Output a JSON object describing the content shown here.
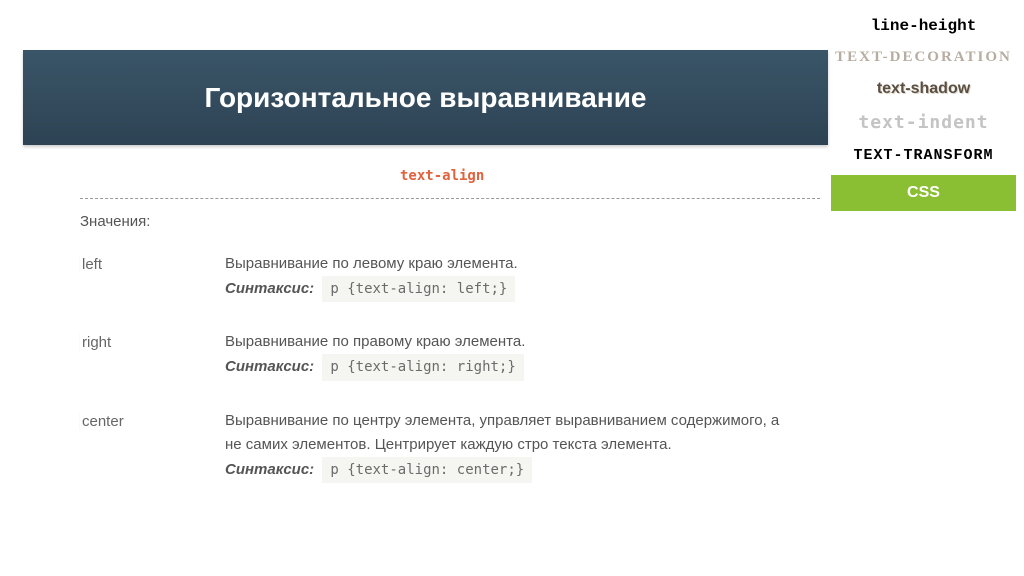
{
  "header": {
    "title": "Горизонтальное выравнивание"
  },
  "sidebar": {
    "items": [
      {
        "label": "line-height"
      },
      {
        "label": "TEXT-DECORATION"
      },
      {
        "label": "text-shadow"
      },
      {
        "label": "text-indent"
      },
      {
        "label": "TEXT-TRANSFORM"
      }
    ],
    "css_label": "CSS"
  },
  "subtitle": "text-align",
  "values_label": "Значения:",
  "rows": [
    {
      "key": "left",
      "desc": "Выравнивание по левому краю элемента.",
      "syntax_label": "Синтаксис:",
      "code": "p  {text-align: left;}"
    },
    {
      "key": "right",
      "desc": "Выравнивание по правому краю элемента.",
      "syntax_label": "Синтаксис:",
      "code": "p  {text-align: right;}"
    },
    {
      "key": "center",
      "desc": "Выравнивание по центру элемента, управляет выравниванием содержимого, а не самих элементов. Центрирует каждую стро  текста элемента.",
      "syntax_label": "Синтаксис:",
      "code": "p  {text-align: center;}"
    }
  ]
}
